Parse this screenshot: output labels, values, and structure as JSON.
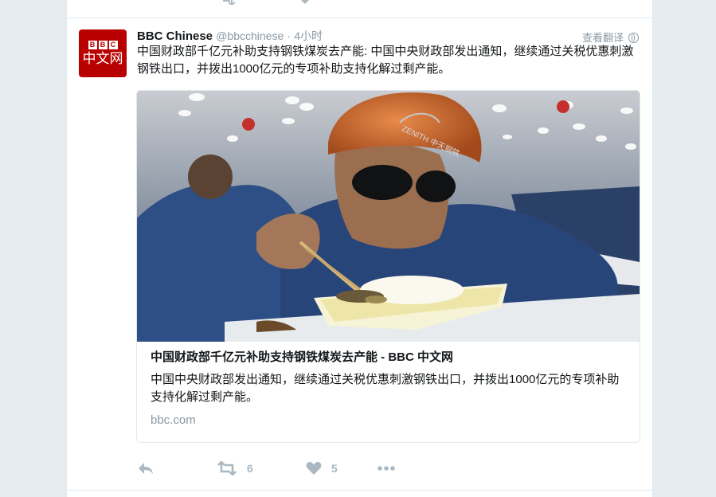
{
  "tweet": {
    "author_name": "BBC Chinese",
    "handle": "@bbcchinese",
    "separator": "·",
    "time": "4小时",
    "translate_label": "查看翻译",
    "text": "中国财政部千亿元补助支持钢铁煤炭去产能: 中国中央财政部发出通知，继续通过关税优惠刺激钢铁出口，并拨出1000亿元的专项补助支持化解过剩产能。",
    "avatar": {
      "bbc_letters": [
        "B",
        "B",
        "C"
      ],
      "label": "中文网",
      "color": "#b80000"
    }
  },
  "card": {
    "title": "中国财政部千亿元补助支持钢铁煤炭去产能 - BBC 中文网",
    "description": "中国中央财政部发出通知，继续通过关税优惠刺激钢铁出口，并拨出1000亿元的专项补助支持化解过剩产能。",
    "domain": "bbc.com",
    "helmet_text": "ZENITH 中天钢铁"
  },
  "actions": {
    "reply_icon": "reply-icon",
    "retweet_icon": "retweet-icon",
    "retweet_count": "6",
    "like_icon": "heart-icon",
    "like_count": "5",
    "more_icon": "more-icon"
  },
  "colors": {
    "page_bg": "#e6ecf0",
    "muted": "#8899a6",
    "action_gray": "#aab8c2",
    "text": "#14171a"
  }
}
